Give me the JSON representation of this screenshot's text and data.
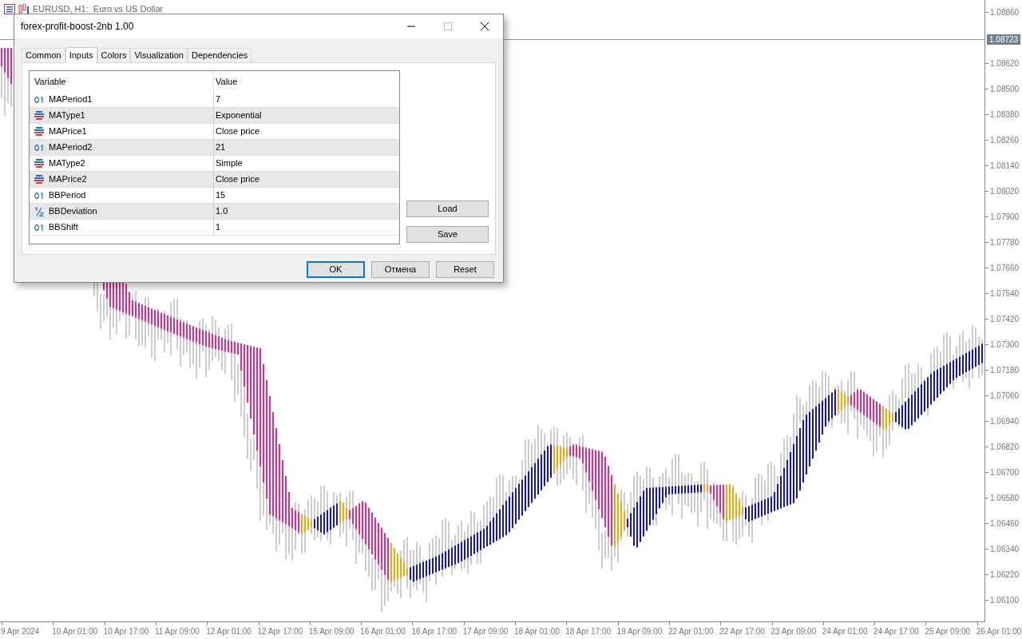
{
  "chart": {
    "title": "EURUSD, H1:  Euro vs US Dollar",
    "price_labels": [
      "1.08860",
      "1.08620",
      "1.08500",
      "1.08380",
      "1.08260",
      "1.08140",
      "1.08020",
      "1.07900",
      "1.07780",
      "1.07660",
      "1.07540",
      "1.07420",
      "1.07300",
      "1.07180",
      "1.07060",
      "1.06940",
      "1.06820",
      "1.06700",
      "1.06580",
      "1.06460",
      "1.06340",
      "1.06220",
      "1.06100"
    ],
    "current_price": "1.08723",
    "time_labels": [
      "9 Apr 2024",
      "10 Apr 01:00",
      "10 Apr 17:00",
      "11 Apr 09:00",
      "12 Apr 01:00",
      "12 Apr 17:00",
      "15 Apr 09:00",
      "16 Apr 01:00",
      "16 Apr 17:00",
      "17 Apr 09:00",
      "18 Apr 01:00",
      "18 Apr 17:00",
      "19 Apr 09:00",
      "22 Apr 01:00",
      "22 Apr 17:00",
      "23 Apr 09:00",
      "24 Apr 01:00",
      "24 Apr 17:00",
      "25 Apr 09:00",
      "26 Apr 01:00"
    ]
  },
  "dialog": {
    "title": "forex-profit-boost-2nb 1.00",
    "tabs": [
      {
        "label": "Common",
        "selected": false
      },
      {
        "label": "Inputs",
        "selected": true
      },
      {
        "label": "Colors",
        "selected": false
      },
      {
        "label": "Visualization",
        "selected": false
      },
      {
        "label": "Dependencies",
        "selected": false
      }
    ],
    "table": {
      "columns": [
        "Variable",
        "Value"
      ],
      "rows": [
        {
          "kind": "int",
          "variable": "MAPeriod1",
          "value": "7"
        },
        {
          "kind": "enum",
          "variable": "MAType1",
          "value": "Exponential"
        },
        {
          "kind": "enum",
          "variable": "MAPrice1",
          "value": "Close price"
        },
        {
          "kind": "int",
          "variable": "MAPeriod2",
          "value": "21"
        },
        {
          "kind": "enum",
          "variable": "MAType2",
          "value": "Simple"
        },
        {
          "kind": "enum",
          "variable": "MAPrice2",
          "value": "Close price"
        },
        {
          "kind": "int",
          "variable": "BBPeriod",
          "value": "15"
        },
        {
          "kind": "double",
          "variable": "BBDeviation",
          "value": "1.0"
        },
        {
          "kind": "int",
          "variable": "BBShift",
          "value": "1"
        }
      ]
    },
    "side_buttons": [
      "Load",
      "Save"
    ],
    "buttons": [
      {
        "label": "OK",
        "default": true
      },
      {
        "label": "Отмена",
        "default": false
      },
      {
        "label": "Reset",
        "default": false
      }
    ]
  }
}
